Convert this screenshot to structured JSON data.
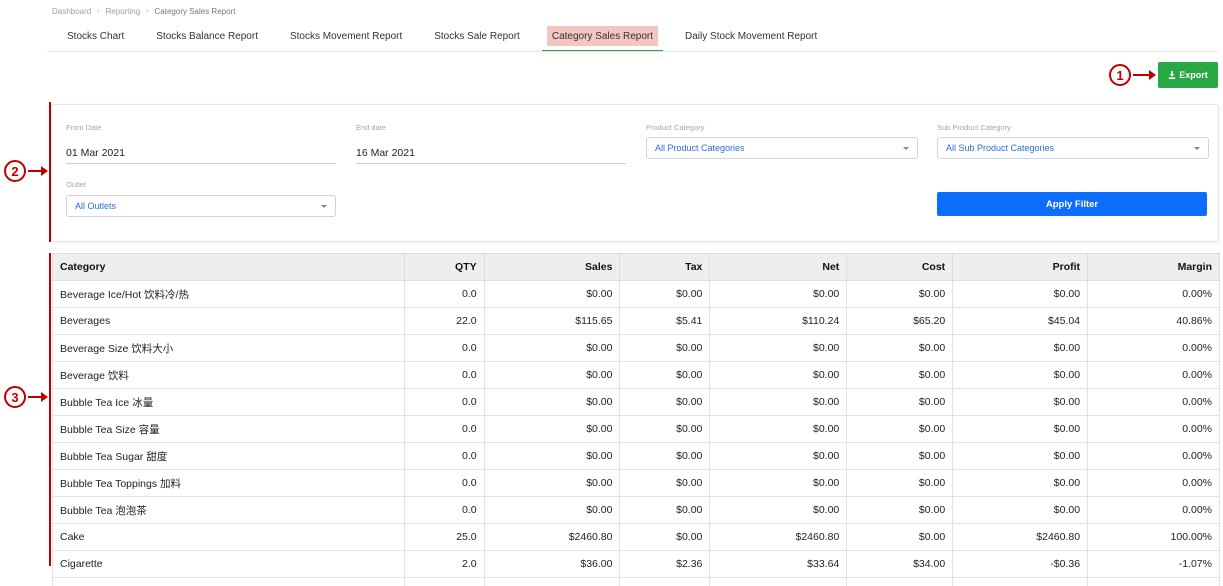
{
  "breadcrumb": {
    "items": [
      "Dashboard",
      "Reporting",
      "Category Sales Report"
    ]
  },
  "tabs": [
    {
      "label": "Stocks Chart"
    },
    {
      "label": "Stocks Balance Report"
    },
    {
      "label": "Stocks Movement Report"
    },
    {
      "label": "Stocks Sale Report"
    },
    {
      "label": "Category Sales Report",
      "active": true
    },
    {
      "label": "Daily Stock Movement Report"
    }
  ],
  "toolbar": {
    "export_label": "Export",
    "export_icon": "download-icon"
  },
  "callouts": [
    "1",
    "2",
    "3"
  ],
  "filters": {
    "from_date": {
      "label": "From Date",
      "value": "01 Mar 2021"
    },
    "end_date": {
      "label": "End date",
      "value": "16 Mar 2021"
    },
    "product_category": {
      "label": "Product Category",
      "value": "All Product Categories"
    },
    "sub_product_category": {
      "label": "Sub Product Category",
      "value": "All Sub Product Categories"
    },
    "outlet": {
      "label": "Outlet",
      "value": "All Outlets"
    },
    "apply_label": "Apply Filter"
  },
  "table": {
    "columns": [
      "Category",
      "QTY",
      "Sales",
      "Tax",
      "Net",
      "Cost",
      "Profit",
      "Margin"
    ],
    "rows": [
      [
        "Beverage Ice/Hot 饮料冷/热",
        "0.0",
        "$0.00",
        "$0.00",
        "$0.00",
        "$0.00",
        "$0.00",
        "0.00%"
      ],
      [
        "Beverages",
        "22.0",
        "$115.65",
        "$5.41",
        "$110.24",
        "$65.20",
        "$45.04",
        "40.86%"
      ],
      [
        "Beverage Size 饮料大小",
        "0.0",
        "$0.00",
        "$0.00",
        "$0.00",
        "$0.00",
        "$0.00",
        "0.00%"
      ],
      [
        "Beverage 饮料",
        "0.0",
        "$0.00",
        "$0.00",
        "$0.00",
        "$0.00",
        "$0.00",
        "0.00%"
      ],
      [
        "Bubble Tea Ice 冰量",
        "0.0",
        "$0.00",
        "$0.00",
        "$0.00",
        "$0.00",
        "$0.00",
        "0.00%"
      ],
      [
        "Bubble Tea Size 容量",
        "0.0",
        "$0.00",
        "$0.00",
        "$0.00",
        "$0.00",
        "$0.00",
        "0.00%"
      ],
      [
        "Bubble Tea Sugar 甜度",
        "0.0",
        "$0.00",
        "$0.00",
        "$0.00",
        "$0.00",
        "$0.00",
        "0.00%"
      ],
      [
        "Bubble Tea Toppings 加料",
        "0.0",
        "$0.00",
        "$0.00",
        "$0.00",
        "$0.00",
        "$0.00",
        "0.00%"
      ],
      [
        "Bubble Tea 泡泡茶",
        "0.0",
        "$0.00",
        "$0.00",
        "$0.00",
        "$0.00",
        "$0.00",
        "0.00%"
      ],
      [
        "Cake",
        "25.0",
        "$2460.80",
        "$0.00",
        "$2460.80",
        "$0.00",
        "$2460.80",
        "100.00%"
      ],
      [
        "Cigarette",
        "2.0",
        "$36.00",
        "$2.36",
        "$33.64",
        "$34.00",
        "-$0.36",
        "-1.07%"
      ],
      [
        "",
        "",
        "",
        "",
        "",
        "",
        "",
        ""
      ]
    ]
  },
  "colors": {
    "export": "#28a745",
    "apply": "#0d6efd",
    "active_tab_bg": "#f3c6c0",
    "active_tab_underline": "#2e9e4f",
    "callout": "#c00000",
    "select_text": "#2a6fd6"
  }
}
